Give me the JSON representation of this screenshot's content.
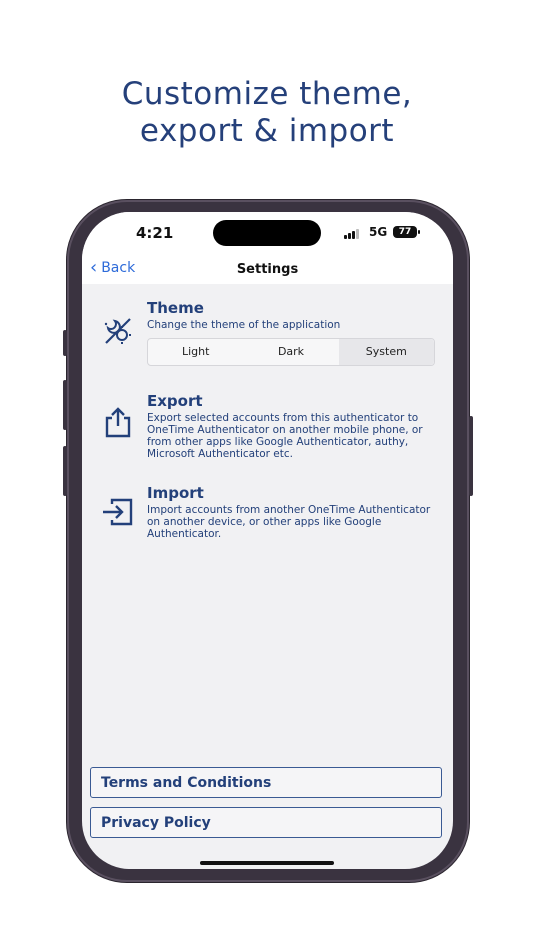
{
  "headline": {
    "line1": "Customize theme,",
    "line2": "export & import"
  },
  "status_bar": {
    "time": "4:21",
    "network": "5G",
    "battery": "77"
  },
  "nav": {
    "back_label": "Back",
    "title": "Settings"
  },
  "theme": {
    "title": "Theme",
    "description": "Change the theme of the application",
    "options": [
      "Light",
      "Dark",
      "System"
    ],
    "selected": "System",
    "icon": "theme-icon"
  },
  "export": {
    "title": "Export",
    "description": "Export selected accounts from this authenticator to OneTime Authenticator on another mobile phone, or from other apps like Google Authenticator, authy, Microsoft Authenticator etc.",
    "icon": "share-icon"
  },
  "import": {
    "title": "Import",
    "description": "Import accounts from another OneTime Authenticator on another device, or other apps like Google Authenticator.",
    "icon": "import-icon"
  },
  "links": {
    "terms": "Terms and Conditions",
    "privacy": "Privacy Policy"
  },
  "colors": {
    "accent": "#23407a",
    "link": "#2e6bd9",
    "background": "#f1f1f3"
  }
}
